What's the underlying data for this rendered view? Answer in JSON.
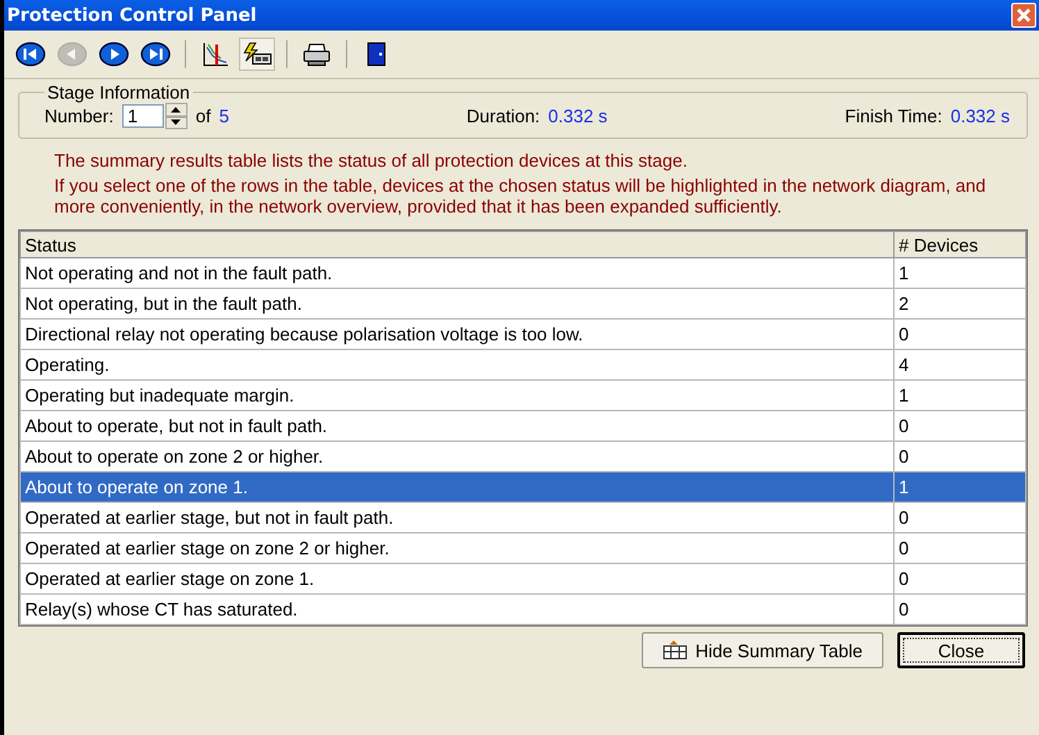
{
  "window": {
    "title": "Protection Control Panel"
  },
  "toolbar": [
    {
      "kind": "first",
      "disabled": false,
      "selected": false
    },
    {
      "kind": "prev",
      "disabled": true,
      "selected": false
    },
    {
      "kind": "next",
      "disabled": false,
      "selected": false
    },
    {
      "kind": "last",
      "disabled": false,
      "selected": false
    },
    {
      "kind": "sep"
    },
    {
      "kind": "chart",
      "disabled": false,
      "selected": false
    },
    {
      "kind": "fault",
      "disabled": false,
      "selected": true
    },
    {
      "kind": "sep"
    },
    {
      "kind": "print",
      "disabled": false,
      "selected": false
    },
    {
      "kind": "sep"
    },
    {
      "kind": "exit",
      "disabled": false,
      "selected": false
    }
  ],
  "stage": {
    "legend": "Stage Information",
    "number_label": "Number:",
    "number": "1",
    "of_label": "of",
    "of_value": "5",
    "duration_label": "Duration:",
    "duration": "0.332 s",
    "finish_label": "Finish Time:",
    "finish": "0.332 s"
  },
  "info": [
    "The summary results table lists the status of all protection devices at this stage.",
    "If you select one of the rows in the table, devices at the chosen status will be highlighted in the network diagram, and more conveniently, in the network overview, provided that it has been expanded sufficiently."
  ],
  "table": {
    "columns": [
      "Status",
      "# Devices"
    ],
    "rows": [
      {
        "status": "Not operating and not in the fault path.",
        "devices": "1",
        "selected": false
      },
      {
        "status": "Not operating, but in the fault path.",
        "devices": "2",
        "selected": false
      },
      {
        "status": "Directional relay not operating because polarisation voltage is too low.",
        "devices": "0",
        "selected": false
      },
      {
        "status": "Operating.",
        "devices": "4",
        "selected": false
      },
      {
        "status": "Operating but inadequate margin.",
        "devices": "1",
        "selected": false
      },
      {
        "status": "About to operate, but not in fault path.",
        "devices": "0",
        "selected": false
      },
      {
        "status": "About to operate on zone 2 or higher.",
        "devices": "0",
        "selected": false
      },
      {
        "status": "About to operate on zone 1.",
        "devices": "1",
        "selected": true
      },
      {
        "status": "Operated at earlier stage, but not in fault path.",
        "devices": "0",
        "selected": false
      },
      {
        "status": "Operated at earlier stage on zone 2 or higher.",
        "devices": "0",
        "selected": false
      },
      {
        "status": "Operated at earlier stage on zone 1.",
        "devices": "0",
        "selected": false
      },
      {
        "status": "Relay(s) whose CT has saturated.",
        "devices": "0",
        "selected": false
      }
    ]
  },
  "buttons": [
    {
      "kind": "table",
      "label": "Hide Summary Table",
      "selected": false
    },
    {
      "kind": "close",
      "label": "Close",
      "selected": true
    }
  ]
}
